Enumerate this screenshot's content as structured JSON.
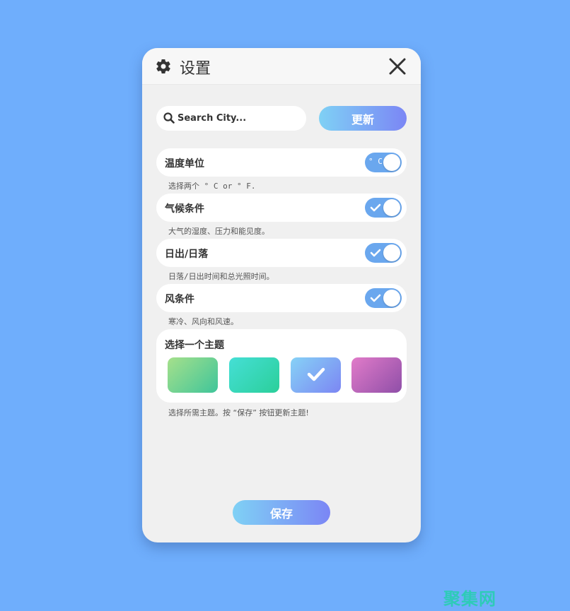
{
  "header": {
    "title": "设置",
    "settings_icon": "gear-icon",
    "close_icon": "close-icon"
  },
  "search": {
    "placeholder": "Search City...",
    "value": "",
    "icon": "search-icon"
  },
  "update_button": {
    "label": "更新"
  },
  "settings": [
    {
      "label": "温度单位",
      "toggle_text": "° C",
      "enabled": true,
      "description": "选择两个 ° C or ° F."
    },
    {
      "label": "气候条件",
      "enabled": true,
      "description": "大气的湿度、压力和能见度。"
    },
    {
      "label": "日出/日落",
      "enabled": true,
      "description": "日落/日出时间和总光照时间。"
    },
    {
      "label": "风条件",
      "enabled": true,
      "description": "寒冷、风向和风速。"
    }
  ],
  "theme": {
    "title": "选择一个主题",
    "description": "选择所需主题。按 “保存” 按钮更新主题!",
    "selected_index": 2,
    "swatches": [
      {
        "from": "#a6e08b",
        "to": "#3fc59a"
      },
      {
        "from": "#45dfd6",
        "to": "#2bcf9a"
      },
      {
        "from": "#86d2f6",
        "to": "#7c86f3"
      },
      {
        "from": "#e17bc9",
        "to": "#8f4fa8"
      }
    ]
  },
  "save_button": {
    "label": "保存"
  },
  "watermark": "聚集网",
  "colors": {
    "background": "#6faefc",
    "toggle_on": "#6aa7ee",
    "gradient_start": "#7fd1f5",
    "gradient_end": "#7b86f5",
    "watermark": "#2ecbb8"
  }
}
